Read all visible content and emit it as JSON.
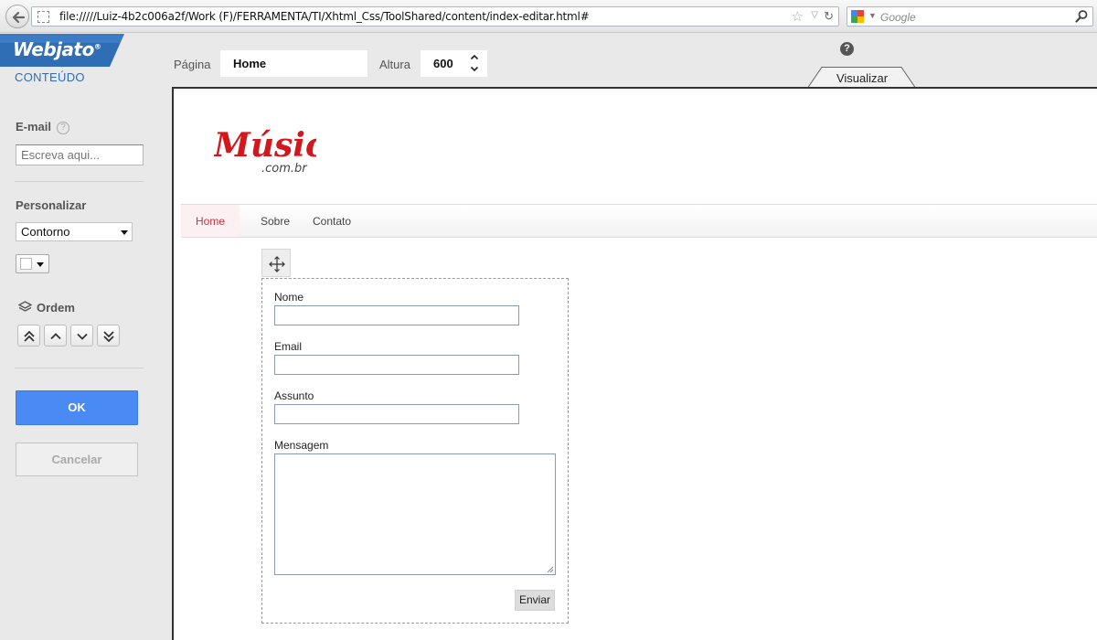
{
  "browser": {
    "url": "file://///Luiz-4b2c006a2f/Work  (F)/FERRAMENTA/TI/Xhtml_Css/ToolShared/content/index-editar.html#",
    "search_placeholder": "Google"
  },
  "editor": {
    "brand": "Webjato",
    "brand_mark": "®",
    "section_title": "CONTEÚDO",
    "email_label": "E-mail",
    "email_placeholder": "Escreva aqui...",
    "customize_label": "Personalizar",
    "border_select_value": "Contorno",
    "swatch_color": "#ffffff",
    "order_label": "Ordem",
    "order_buttons": [
      "bring-to-front",
      "move-up",
      "move-down",
      "send-to-back"
    ],
    "ok_label": "OK",
    "cancel_label": "Cancelar"
  },
  "topbar": {
    "page_label": "Página",
    "page_value": "Home",
    "height_label": "Altura",
    "height_value": "600",
    "help_symbol": "?",
    "preview_tab": "Visualizar"
  },
  "site": {
    "logo_text": "Música",
    "logo_subtext": ".com.br",
    "nav": [
      {
        "label": "Home",
        "active": true
      },
      {
        "label": "Sobre",
        "active": false
      },
      {
        "label": "Contato",
        "active": false
      }
    ],
    "form": {
      "name_label": "Nome",
      "email_label": "Email",
      "subject_label": "Assunto",
      "message_label": "Mensagem",
      "submit_label": "Enviar"
    }
  },
  "colors": {
    "brand_blue": "#2f6db5",
    "ok_blue": "#4a8af4",
    "logo_red": "#d3171d",
    "nav_active": "#c5373c"
  }
}
